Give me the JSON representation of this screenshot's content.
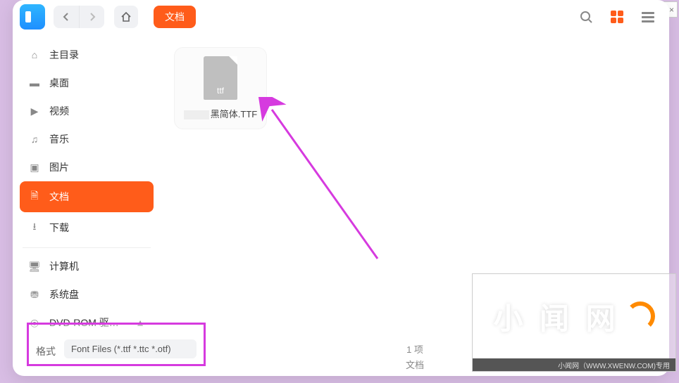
{
  "toolbar": {
    "breadcrumb": "文档"
  },
  "sidebar": {
    "items": [
      {
        "icon": "⌂",
        "label": "主目录"
      },
      {
        "icon": "▬",
        "label": "桌面"
      },
      {
        "icon": "▶",
        "label": "视频"
      },
      {
        "icon": "♫",
        "label": "音乐"
      },
      {
        "icon": "▣",
        "label": "图片"
      },
      {
        "icon": "🗎",
        "label": "文档"
      },
      {
        "icon": "⭳",
        "label": "下载"
      }
    ],
    "devices": [
      {
        "icon": "🖥",
        "label": "计算机"
      },
      {
        "icon": "⛃",
        "label": "系统盘"
      },
      {
        "icon": "◎",
        "label": "DVD-ROM 驱…",
        "eject": "▲"
      }
    ],
    "active_index": 5
  },
  "files": [
    {
      "ext_badge": "ttf",
      "name_suffix": "黑简体.TTF"
    }
  ],
  "status": {
    "count_text": "1 项",
    "location_text": "文档"
  },
  "format": {
    "label": "格式",
    "value": "Font Files (*.ttf *.ttc *.otf)"
  },
  "watermark": {
    "brand_cn": "小 闻 网",
    "url": "XWENW.COM",
    "footer": "小闻网（WWW.XWENW.COM)专用"
  },
  "tray": {
    "close": "×"
  }
}
